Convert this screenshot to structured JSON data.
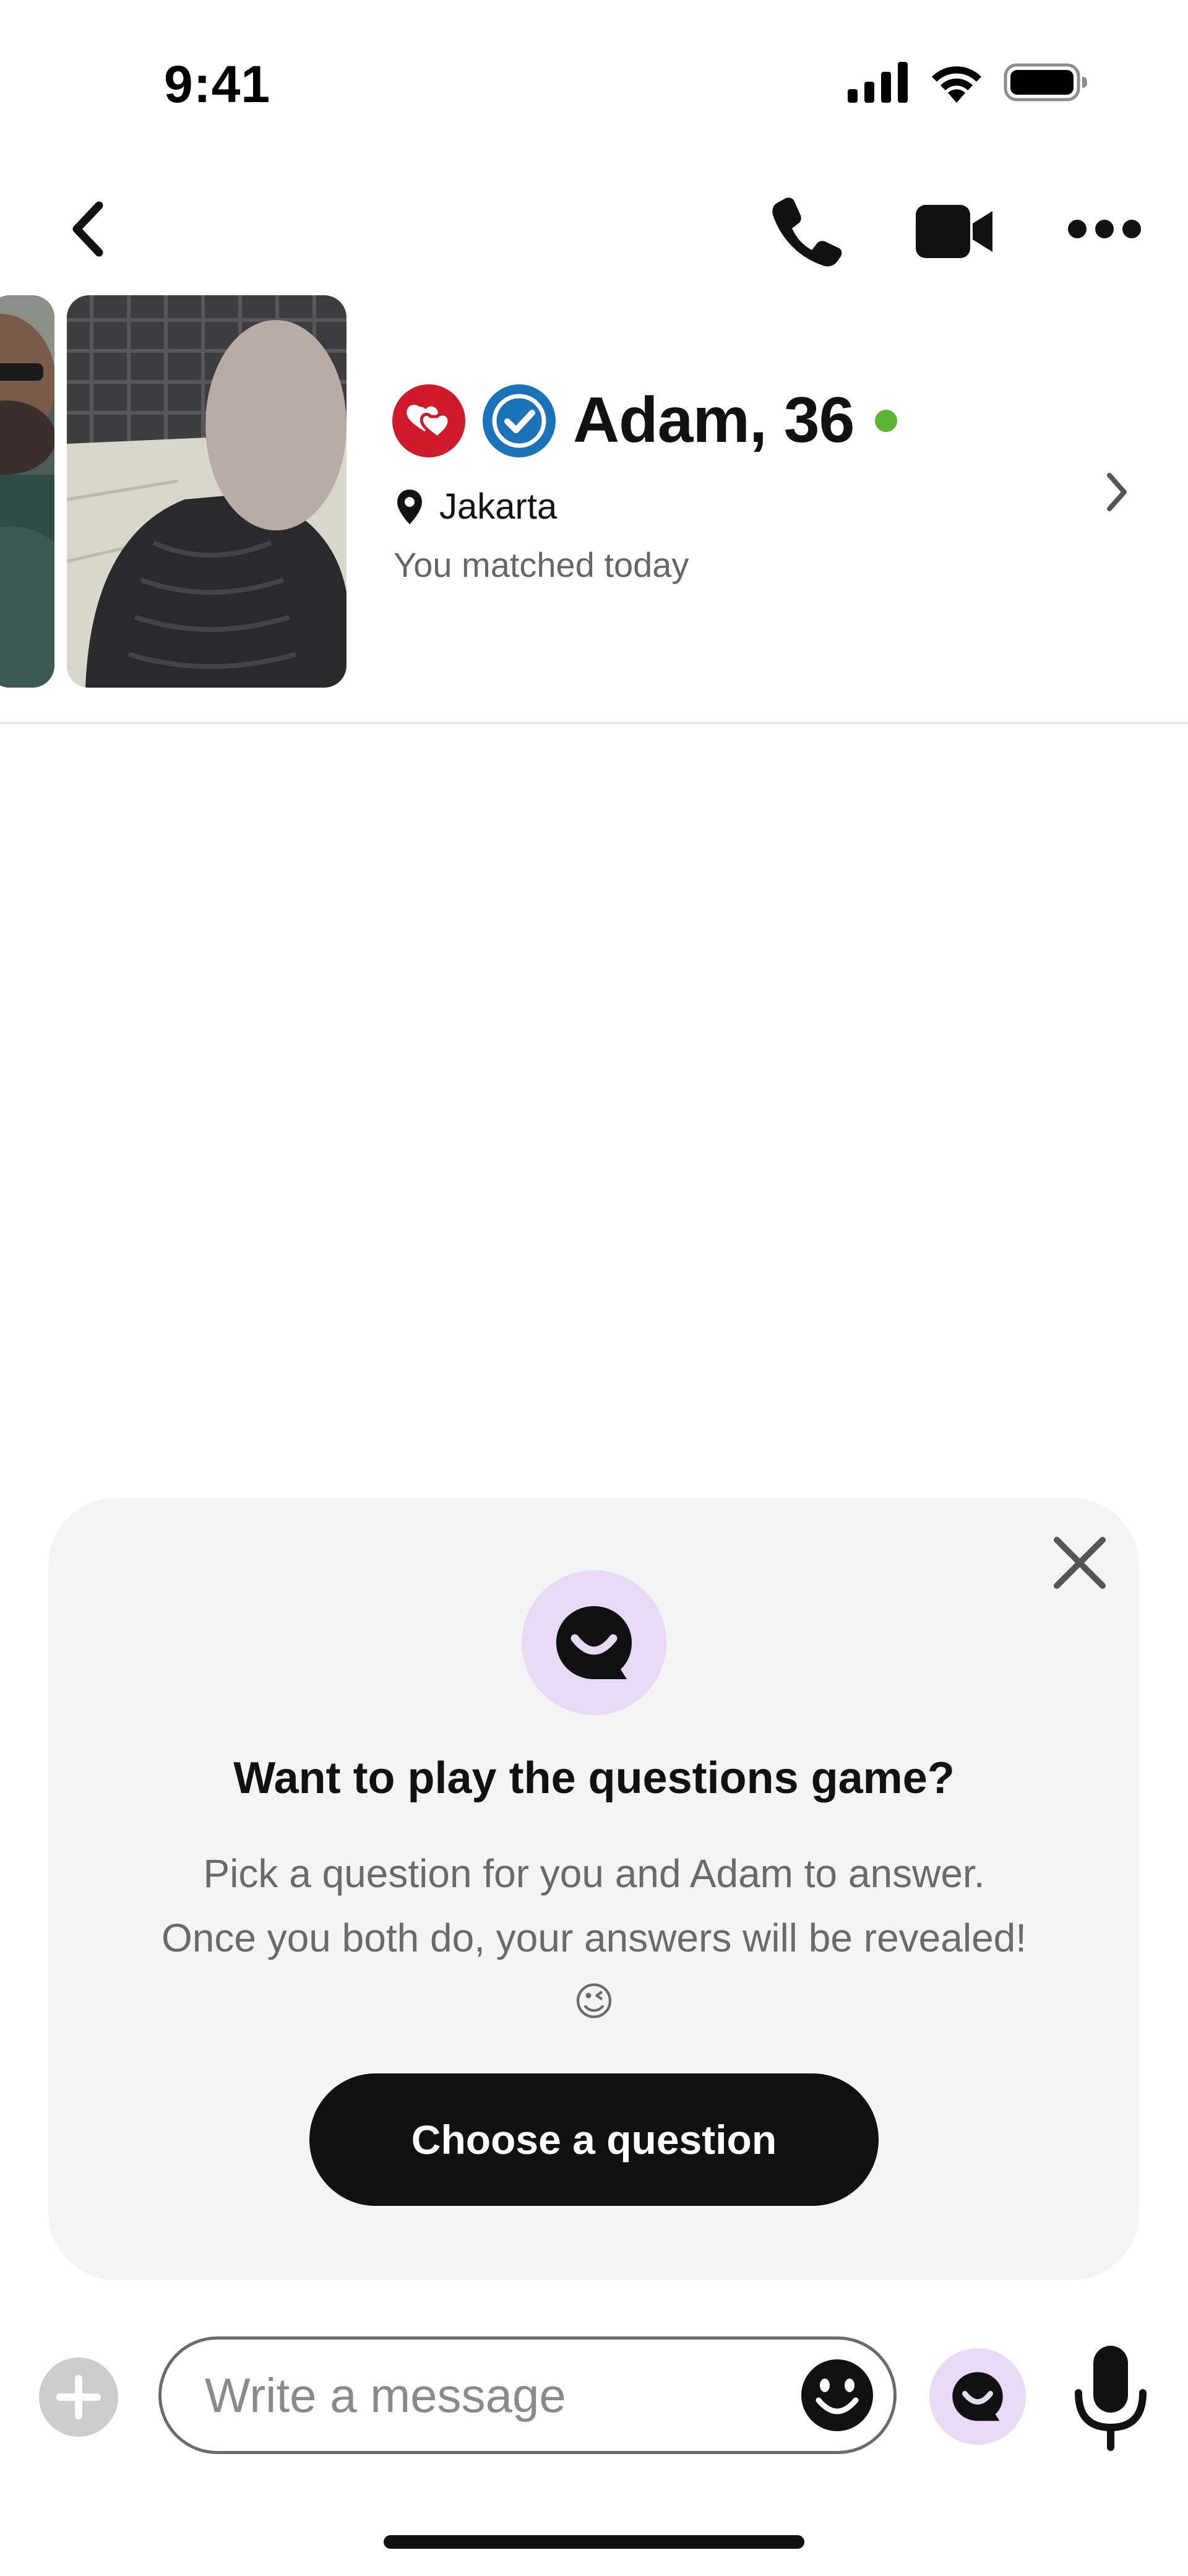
{
  "status_bar": {
    "time": "9:41"
  },
  "header": {
    "back_icon": "chevron-left-icon",
    "call_icon": "phone-icon",
    "video_icon": "video-camera-icon",
    "more_icon": "more-horizontal-icon"
  },
  "profile": {
    "name": "Adam, 36",
    "location": "Jakarta",
    "matched_text": "You matched today",
    "online": true,
    "badges": [
      "heart-badge-icon",
      "verified-badge-icon"
    ],
    "colors": {
      "heart_badge": "#d0192b",
      "verified_badge": "#1a73b8",
      "online_dot": "#5bb333"
    }
  },
  "questions_card": {
    "title": "Want to play the questions game?",
    "body_line1": "Pick a question for you and Adam to answer.",
    "body_line2": "Once you both do, your answers will be revealed!",
    "emoji": "😉",
    "cta_label": "Choose a question",
    "accent_color": "#e8d9f7"
  },
  "composer": {
    "placeholder": "Write a message"
  }
}
